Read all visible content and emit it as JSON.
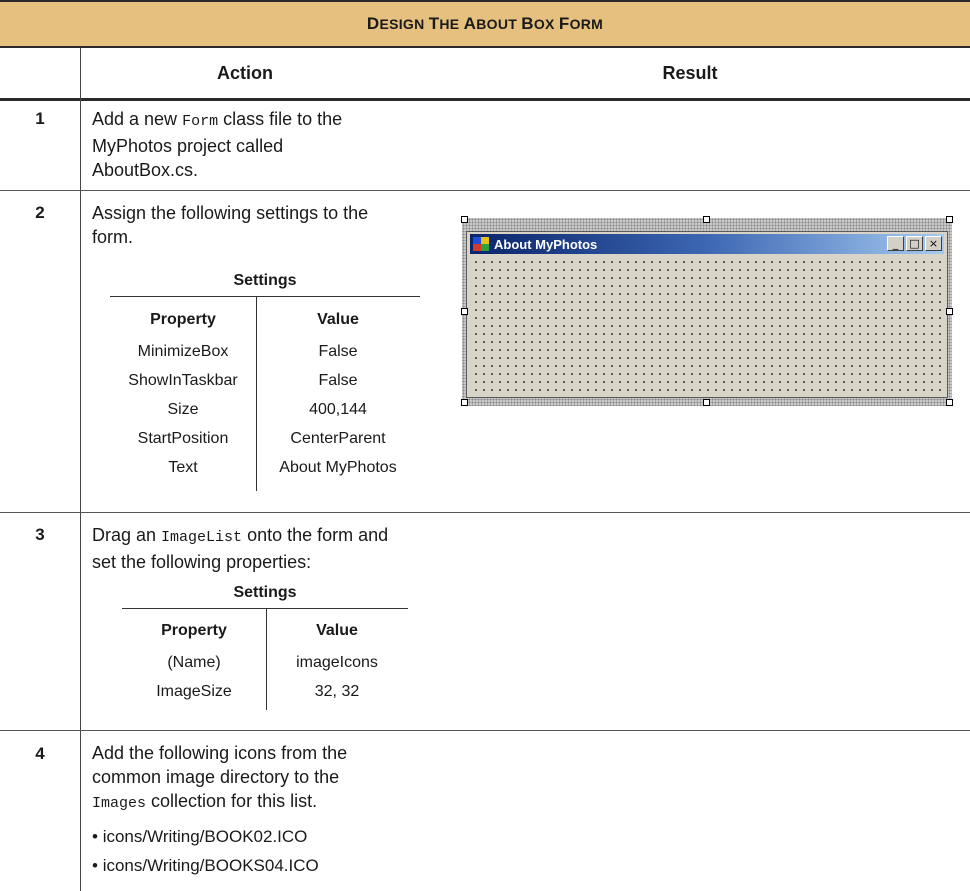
{
  "table_title": "Design the about box form",
  "columns": {
    "action": "Action",
    "result": "Result"
  },
  "steps": [
    {
      "number": "1",
      "text_parts": [
        "Add a new ",
        "Form",
        " class file to the MyPhotos project called AboutBox.cs."
      ]
    },
    {
      "number": "2",
      "text": "Assign the following settings to the form.",
      "settings": {
        "title": "Settings",
        "headers": [
          "Property",
          "Value"
        ],
        "rows": [
          [
            "MinimizeBox",
            "False"
          ],
          [
            "ShowInTaskbar",
            "False"
          ],
          [
            "Size",
            "400,144"
          ],
          [
            "StartPosition",
            "CenterParent"
          ],
          [
            "Text",
            "About MyPhotos"
          ]
        ]
      },
      "result_form": {
        "window_title": "About MyPhotos",
        "buttons": [
          "_",
          "□",
          "×"
        ]
      }
    },
    {
      "number": "3",
      "text_parts": [
        "Drag an ",
        "ImageList",
        " onto the form and set the following properties:"
      ],
      "settings": {
        "title": "Settings",
        "headers": [
          "Property",
          "Value"
        ],
        "rows": [
          [
            "(Name)",
            "imageIcons"
          ],
          [
            "ImageSize",
            "32, 32"
          ]
        ]
      }
    },
    {
      "number": "4",
      "text_parts": [
        "Add the following icons from the common image directory to the ",
        "Images",
        " collection for this list."
      ],
      "bullets": [
        "icons/Writing/BOOK02.ICO",
        "icons/Writing/BOOKS04.ICO"
      ]
    }
  ],
  "colors": {
    "header_band": "#e6c07e",
    "titlebar_dark": "#0a246a",
    "titlebar_light": "#a6caf0"
  }
}
